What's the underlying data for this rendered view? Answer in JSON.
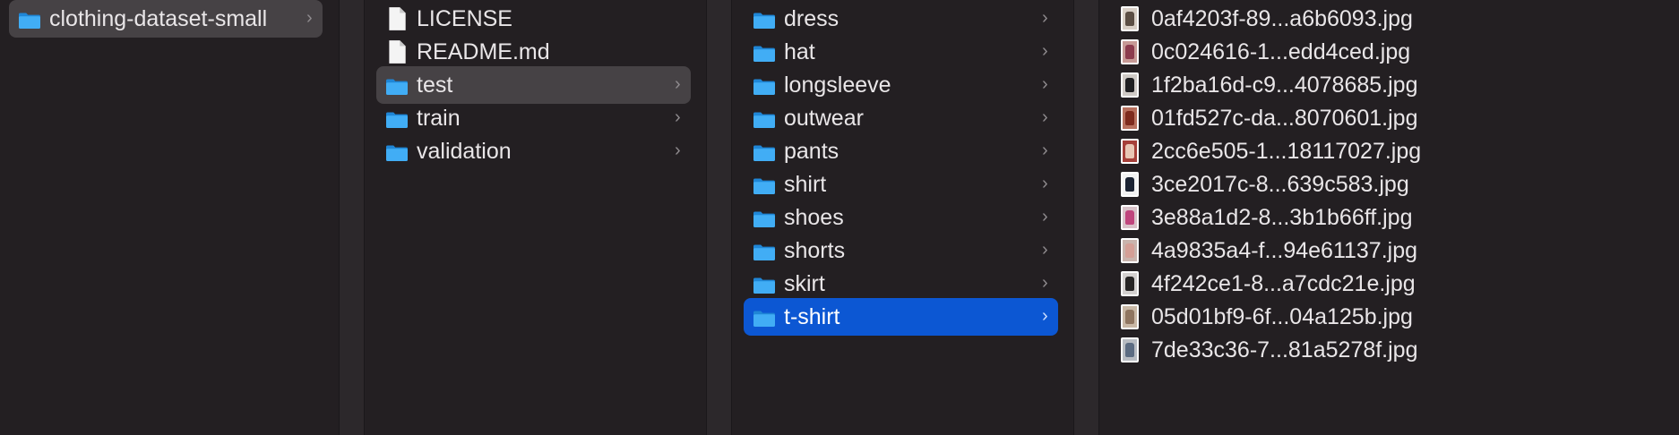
{
  "column1": {
    "items": [
      {
        "label": "clothing-dataset-small",
        "kind": "folder",
        "selected": true
      }
    ]
  },
  "column2": {
    "items": [
      {
        "label": "LICENSE",
        "kind": "file"
      },
      {
        "label": "README.md",
        "kind": "file"
      },
      {
        "label": "test",
        "kind": "folder",
        "selected": true
      },
      {
        "label": "train",
        "kind": "folder"
      },
      {
        "label": "validation",
        "kind": "folder"
      }
    ]
  },
  "column3": {
    "items": [
      {
        "label": "dress",
        "kind": "folder"
      },
      {
        "label": "hat",
        "kind": "folder"
      },
      {
        "label": "longsleeve",
        "kind": "folder"
      },
      {
        "label": "outwear",
        "kind": "folder"
      },
      {
        "label": "pants",
        "kind": "folder"
      },
      {
        "label": "shirt",
        "kind": "folder"
      },
      {
        "label": "shoes",
        "kind": "folder"
      },
      {
        "label": "shorts",
        "kind": "folder"
      },
      {
        "label": "skirt",
        "kind": "folder"
      },
      {
        "label": "t-shirt",
        "kind": "folder",
        "active": true
      }
    ]
  },
  "column4": {
    "items": [
      {
        "label": "0af4203f-89...a6b6093.jpg",
        "kind": "image",
        "bg": "#d8cfc6",
        "fg": "#5b4e44"
      },
      {
        "label": "0c024616-1...edd4ced.jpg",
        "kind": "image",
        "bg": "#c79a96",
        "fg": "#8c3c4e"
      },
      {
        "label": "1f2ba16d-c9...4078685.jpg",
        "kind": "image",
        "bg": "#cfcac6",
        "fg": "#1f1f22"
      },
      {
        "label": "01fd527c-da...8070601.jpg",
        "kind": "image",
        "bg": "#b8705e",
        "fg": "#7e2b1e"
      },
      {
        "label": "2cc6e505-1...18117027.jpg",
        "kind": "image",
        "bg": "#a6403a",
        "fg": "#e8c7b5"
      },
      {
        "label": "3ce2017c-8...639c583.jpg",
        "kind": "image",
        "bg": "#f2f2f2",
        "fg": "#1b2333"
      },
      {
        "label": "3e88a1d2-8...3b1b66ff.jpg",
        "kind": "image",
        "bg": "#d9c2c9",
        "fg": "#c0457d"
      },
      {
        "label": "4a9835a4-f...94e61137.jpg",
        "kind": "image",
        "bg": "#c9b4ad",
        "fg": "#d49f96"
      },
      {
        "label": "4f242ce1-8...a7cdc21e.jpg",
        "kind": "image",
        "bg": "#d3d0cf",
        "fg": "#262424"
      },
      {
        "label": "05d01bf9-6f...04a125b.jpg",
        "kind": "image",
        "bg": "#c9b8a6",
        "fg": "#8f7560"
      },
      {
        "label": "7de33c36-7...81a5278f.jpg",
        "kind": "image",
        "bg": "#b8bcc2",
        "fg": "#5c6c82"
      }
    ]
  },
  "icons": {
    "folder": "folder-icon",
    "file": "document-icon",
    "image": "image-thumbnail-icon",
    "chevron": "chevron-right-icon"
  },
  "colors": {
    "background": "#231f22",
    "selection": "#464245",
    "active_selection": "#0c57d3",
    "folder_blue": "#3fa9f5"
  }
}
